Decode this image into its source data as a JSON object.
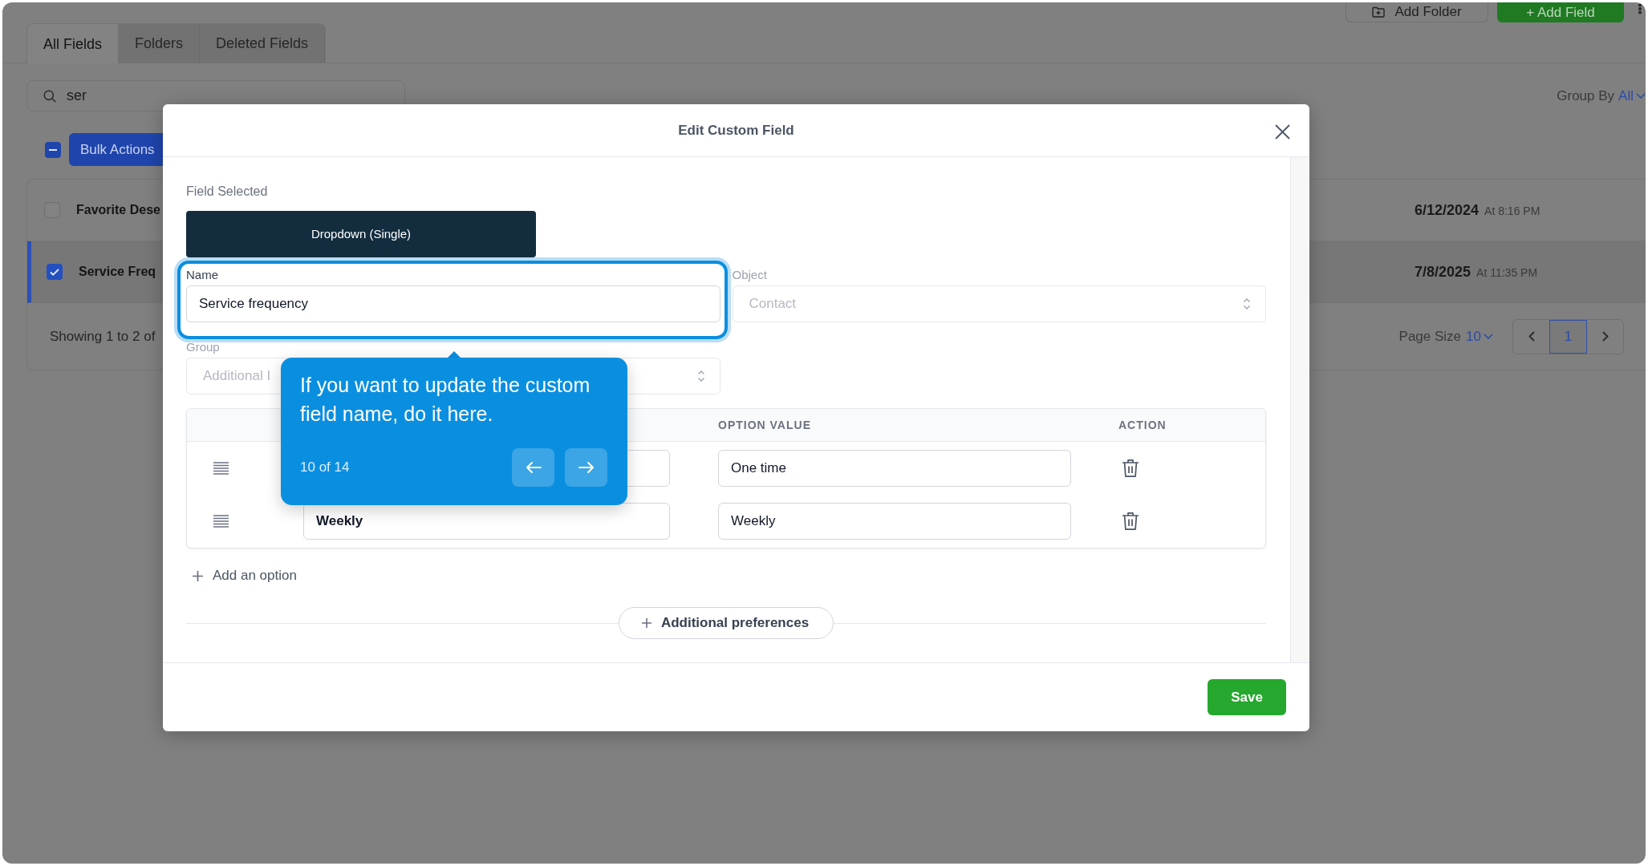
{
  "page": {
    "header_buttons": [
      {
        "kind": "outline",
        "label": "Add Folder"
      },
      {
        "kind": "primary",
        "label": "+ Add Field"
      }
    ],
    "tabs": [
      {
        "label": "All Fields",
        "selected": true
      },
      {
        "label": "Folders",
        "selected": false
      },
      {
        "label": "Deleted Fields",
        "selected": false
      }
    ],
    "search": {
      "value": "ser"
    },
    "group_by": {
      "label": "Group By",
      "value": "All"
    },
    "select_all": {
      "checked": true,
      "partial": true
    },
    "bulk_actions": {
      "label": "Bulk Actions"
    },
    "rows": [
      {
        "name": "Favorite Dese",
        "date": "6/12/2024",
        "time": "At 8:16 PM",
        "checked": false,
        "selected": false
      },
      {
        "name": "Service Freq",
        "date": "7/8/2025",
        "time": "At 11:35 PM",
        "checked": true,
        "selected": true
      }
    ],
    "footer": {
      "showing": "Showing 1 to 2 of",
      "page_size_label": "Page Size",
      "page_size": "10",
      "pages": [
        {
          "label": "1",
          "selected": true
        }
      ]
    }
  },
  "modal": {
    "title": "Edit Custom Field",
    "field_selected_label": "Field Selected",
    "field_type": "Dropdown (Single)",
    "fields": [
      {
        "kind": "text",
        "label": "Name",
        "value": "Service frequency",
        "disabled": false,
        "highlighted": true
      },
      {
        "kind": "select",
        "label": "Object",
        "value": "Contact",
        "disabled": true,
        "highlighted": false
      },
      {
        "kind": "select",
        "label": "Group",
        "value": "Additional I",
        "disabled": true,
        "highlighted": false
      }
    ],
    "options_table": {
      "column_headers": [
        "OPTION VALUE",
        "ACTION"
      ],
      "rows": [
        {
          "value": "One time"
        },
        {
          "label": "Weekly",
          "value": "Weekly"
        }
      ]
    },
    "add_option": "Add an option",
    "preferences_button": "Additional preferences",
    "save_button": "Save"
  },
  "tour": {
    "text": "If you want to update the custom field name, do it here.",
    "step": "10 of 14"
  }
}
